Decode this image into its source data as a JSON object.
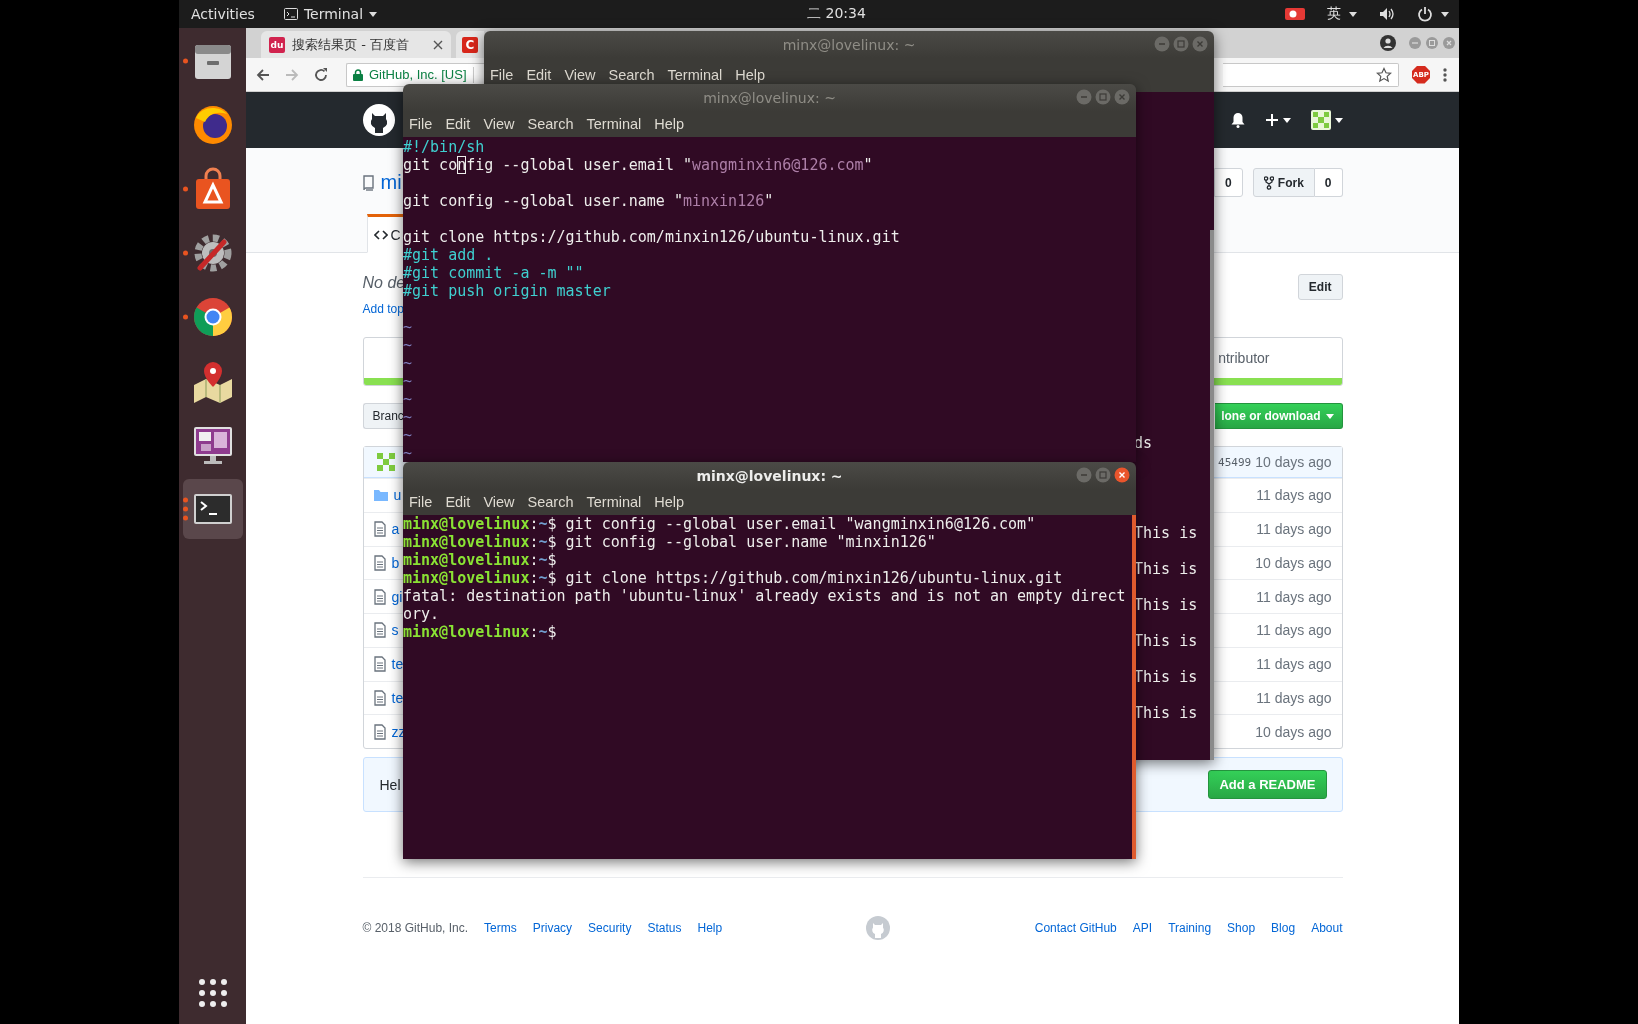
{
  "top_bar": {
    "activities": "Activities",
    "app_menu": "Terminal",
    "clock": "二 20:34",
    "input_method": "英",
    "recording": true
  },
  "dock": {
    "items": [
      {
        "kind": "files",
        "running": true,
        "multiple_windows": false,
        "focused": false
      },
      {
        "kind": "firefox",
        "running": false,
        "multiple_windows": false,
        "focused": false
      },
      {
        "kind": "software",
        "running": true,
        "multiple_windows": false,
        "focused": false
      },
      {
        "kind": "settings",
        "running": true,
        "multiple_windows": false,
        "focused": false
      },
      {
        "kind": "chrome",
        "running": true,
        "multiple_windows": false,
        "focused": false
      },
      {
        "kind": "maps",
        "running": false,
        "multiple_windows": false,
        "focused": false
      },
      {
        "kind": "workspace",
        "running": false,
        "multiple_windows": false,
        "focused": false
      },
      {
        "kind": "terminal",
        "running": true,
        "multiple_windows": true,
        "focused": true
      }
    ]
  },
  "browser": {
    "tabs": [
      {
        "favicon": "du",
        "title": "搜索结果页 - 百度首",
        "selected": false
      },
      {
        "favicon": "C",
        "selected": false
      }
    ],
    "address": {
      "site_identity": "GitHub, Inc. [US]",
      "secure": true
    },
    "adblock_badge": "ABP"
  },
  "github": {
    "repo_name": "mi",
    "watch_count": "0",
    "fork_label": "Fork",
    "fork_count": "0",
    "tabs": [
      {
        "label": "C",
        "selected": true
      }
    ],
    "description": "No de",
    "topics_link": "Add top",
    "edit_label": "Edit",
    "summary_text": "ntributor",
    "branch_label": "Branc",
    "clone_label": "lone or download",
    "commit": {
      "sha": "45499",
      "age": "10 days ago"
    },
    "files": [
      {
        "kind": "folder",
        "name": "u",
        "age": "11 days ago"
      },
      {
        "kind": "file",
        "name": "a",
        "age": "11 days ago"
      },
      {
        "kind": "file",
        "name": "b",
        "age": "10 days ago"
      },
      {
        "kind": "file",
        "name": "gi",
        "age": "11 days ago"
      },
      {
        "kind": "file",
        "name": "s",
        "age": "11 days ago"
      },
      {
        "kind": "file",
        "name": "te",
        "age": "11 days ago"
      },
      {
        "kind": "file",
        "name": "te",
        "age": "11 days ago"
      },
      {
        "kind": "file",
        "name": "zz",
        "age": "10 days ago"
      }
    ],
    "help_text": "Hel",
    "readme_button": "Add a README",
    "footer": {
      "copyright": "© 2018 GitHub, Inc.",
      "left_links": [
        "Terms",
        "Privacy",
        "Security",
        "Status",
        "Help"
      ],
      "right_links": [
        "Contact GitHub",
        "API",
        "Training",
        "Shop",
        "Blog",
        "About"
      ]
    }
  },
  "terminals": [
    {
      "kind": "back",
      "title": "minx@lovelinux: ~",
      "focused": false,
      "menu": [
        "File",
        "Edit",
        "View",
        "Search",
        "Terminal",
        "Help"
      ],
      "lines": [
        {
          "kind": "blank"
        },
        {
          "kind": "blank"
        },
        {
          "kind": "blank"
        },
        {
          "kind": "blank"
        },
        {
          "kind": "blank"
        },
        {
          "kind": "blank"
        },
        {
          "kind": "blank"
        },
        {
          "kind": "blank"
        },
        {
          "kind": "blank"
        },
        {
          "kind": "blank"
        },
        {
          "kind": "blank"
        },
        {
          "kind": "blank"
        },
        {
          "kind": "blank"
        },
        {
          "kind": "blank"
        },
        {
          "kind": "blank"
        },
        {
          "kind": "blank"
        },
        {
          "kind": "blank"
        },
        {
          "kind": "blank"
        },
        {
          "kind": "blank"
        },
        {
          "kind": "text",
          "segments": [
            {
              "kind": "plain",
              "text": "ds"
            }
          ]
        },
        {
          "kind": "blank"
        },
        {
          "kind": "blank"
        },
        {
          "kind": "blank"
        },
        {
          "kind": "blank"
        },
        {
          "kind": "text",
          "segments": [
            {
              "kind": "plain",
              "text": "This is"
            }
          ]
        },
        {
          "kind": "blank"
        },
        {
          "kind": "text",
          "segments": [
            {
              "kind": "plain",
              "text": "This is"
            }
          ]
        },
        {
          "kind": "blank"
        },
        {
          "kind": "text",
          "segments": [
            {
              "kind": "plain",
              "text": "This is"
            }
          ]
        },
        {
          "kind": "blank"
        },
        {
          "kind": "text",
          "segments": [
            {
              "kind": "plain",
              "text": "This is"
            }
          ]
        },
        {
          "kind": "blank"
        },
        {
          "kind": "text",
          "segments": [
            {
              "kind": "plain",
              "text": "This is"
            }
          ]
        },
        {
          "kind": "blank"
        },
        {
          "kind": "text",
          "segments": [
            {
              "kind": "plain",
              "text": "This is"
            }
          ]
        }
      ]
    },
    {
      "kind": "editor",
      "title": "minx@lovelinux: ~",
      "focused": false,
      "menu": [
        "File",
        "Edit",
        "View",
        "Search",
        "Terminal",
        "Help"
      ],
      "lines": [
        {
          "kind": "text",
          "segments": [
            {
              "kind": "comment",
              "text": "#!/bin/sh"
            }
          ]
        },
        {
          "kind": "text",
          "segments": [
            {
              "kind": "plain",
              "text": "git co"
            },
            {
              "kind": "cursor",
              "text": "n"
            },
            {
              "kind": "plain",
              "text": "fig --global user.email \""
            },
            {
              "kind": "string",
              "text": "wangminxin6@126.com"
            },
            {
              "kind": "plain",
              "text": "\""
            }
          ]
        },
        {
          "kind": "blank"
        },
        {
          "kind": "text",
          "segments": [
            {
              "kind": "plain",
              "text": "git config --global user.name \""
            },
            {
              "kind": "string",
              "text": "minxin126"
            },
            {
              "kind": "plain",
              "text": "\""
            }
          ]
        },
        {
          "kind": "blank"
        },
        {
          "kind": "text",
          "segments": [
            {
              "kind": "plain",
              "text": "git clone https://github.com/minxin126/ubuntu-linux.git"
            }
          ]
        },
        {
          "kind": "text",
          "segments": [
            {
              "kind": "comment",
              "text": "#git add ."
            }
          ]
        },
        {
          "kind": "text",
          "segments": [
            {
              "kind": "comment",
              "text": "#git commit -a -m \"\""
            }
          ]
        },
        {
          "kind": "text",
          "segments": [
            {
              "kind": "comment",
              "text": "#git push origin master"
            }
          ]
        },
        {
          "kind": "blank"
        },
        {
          "kind": "text",
          "segments": [
            {
              "kind": "tilde",
              "text": "~"
            }
          ]
        },
        {
          "kind": "text",
          "segments": [
            {
              "kind": "tilde",
              "text": "~"
            }
          ]
        },
        {
          "kind": "text",
          "segments": [
            {
              "kind": "tilde",
              "text": "~"
            }
          ]
        },
        {
          "kind": "text",
          "segments": [
            {
              "kind": "tilde",
              "text": "~"
            }
          ]
        },
        {
          "kind": "text",
          "segments": [
            {
              "kind": "tilde",
              "text": "~"
            }
          ]
        },
        {
          "kind": "text",
          "segments": [
            {
              "kind": "tilde",
              "text": "~"
            }
          ]
        },
        {
          "kind": "text",
          "segments": [
            {
              "kind": "tilde",
              "text": "~"
            }
          ]
        },
        {
          "kind": "text",
          "segments": [
            {
              "kind": "tilde",
              "text": "~"
            }
          ]
        }
      ]
    },
    {
      "kind": "front",
      "title": "minx@lovelinux: ~",
      "focused": true,
      "menu": [
        "File",
        "Edit",
        "View",
        "Search",
        "Terminal",
        "Help"
      ],
      "lines": [
        {
          "kind": "text",
          "segments": [
            {
              "kind": "user",
              "text": "minx@lovelinux"
            },
            {
              "kind": "plain",
              "text": ":"
            },
            {
              "kind": "cwd",
              "text": "~"
            },
            {
              "kind": "plain",
              "text": "$ git config --global user.email \"wangminxin6@126.com\""
            }
          ]
        },
        {
          "kind": "text",
          "segments": [
            {
              "kind": "user",
              "text": "minx@lovelinux"
            },
            {
              "kind": "plain",
              "text": ":"
            },
            {
              "kind": "cwd",
              "text": "~"
            },
            {
              "kind": "plain",
              "text": "$ git config --global user.name \"minxin126\""
            }
          ]
        },
        {
          "kind": "text",
          "segments": [
            {
              "kind": "user",
              "text": "minx@lovelinux"
            },
            {
              "kind": "plain",
              "text": ":"
            },
            {
              "kind": "cwd",
              "text": "~"
            },
            {
              "kind": "plain",
              "text": "$"
            }
          ]
        },
        {
          "kind": "text",
          "segments": [
            {
              "kind": "user",
              "text": "minx@lovelinux"
            },
            {
              "kind": "plain",
              "text": ":"
            },
            {
              "kind": "cwd",
              "text": "~"
            },
            {
              "kind": "plain",
              "text": "$ git clone https://github.com/minxin126/ubuntu-linux.git"
            }
          ]
        },
        {
          "kind": "text",
          "segments": [
            {
              "kind": "plain",
              "text": "fatal: destination path 'ubuntu-linux' already exists and is not an empty direct"
            }
          ]
        },
        {
          "kind": "text",
          "segments": [
            {
              "kind": "plain",
              "text": "ory."
            }
          ]
        },
        {
          "kind": "text",
          "segments": [
            {
              "kind": "user",
              "text": "minx@lovelinux"
            },
            {
              "kind": "plain",
              "text": ":"
            },
            {
              "kind": "cwd",
              "text": "~"
            },
            {
              "kind": "plain",
              "text": "$"
            }
          ]
        }
      ]
    }
  ]
}
